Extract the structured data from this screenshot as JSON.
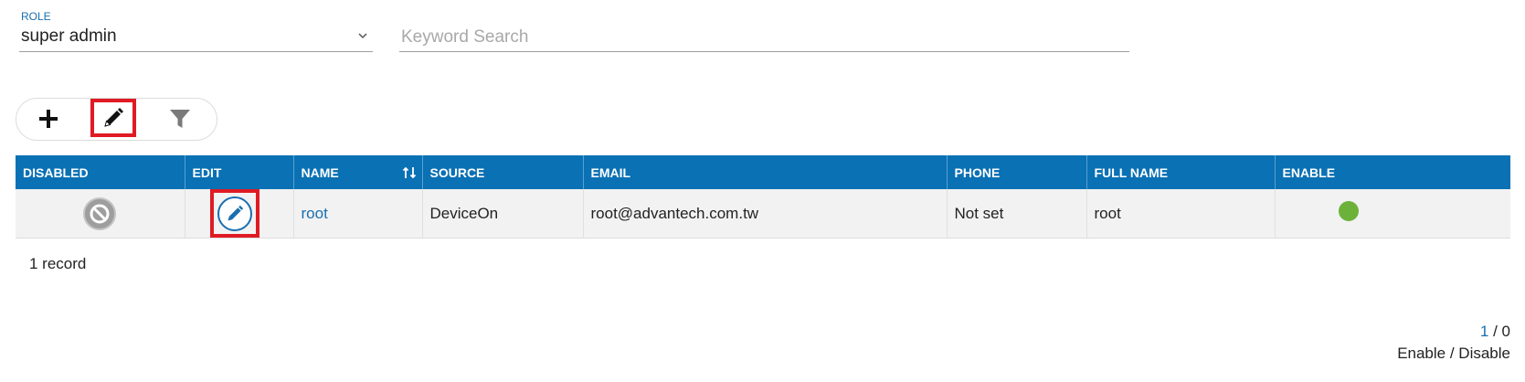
{
  "filters": {
    "role_label": "ROLE",
    "role_value": "super admin",
    "search_placeholder": "Keyword Search",
    "search_value": ""
  },
  "toolbar": {
    "add_icon": "plus-icon",
    "edit_icon": "pencil-icon",
    "filter_icon": "filter-icon"
  },
  "table": {
    "columns": [
      "DISABLED",
      "EDIT",
      "NAME",
      "SOURCE",
      "EMAIL",
      "PHONE",
      "FULL NAME",
      "ENABLE"
    ],
    "rows": [
      {
        "name": "root",
        "source": "DeviceOn",
        "email": "root@advantech.com.tw",
        "phone": "Not set",
        "full_name": "root"
      }
    ]
  },
  "footer": {
    "record_count": "1 record",
    "page_current": "1",
    "page_sep_total": " / 0",
    "legend": "Enable / Disable"
  },
  "colors": {
    "header_bg": "#0a71b4",
    "accent": "#1a6fae",
    "highlight": "#e01b24",
    "enabled": "#6cb23a",
    "disabled": "#9e9e9e"
  }
}
